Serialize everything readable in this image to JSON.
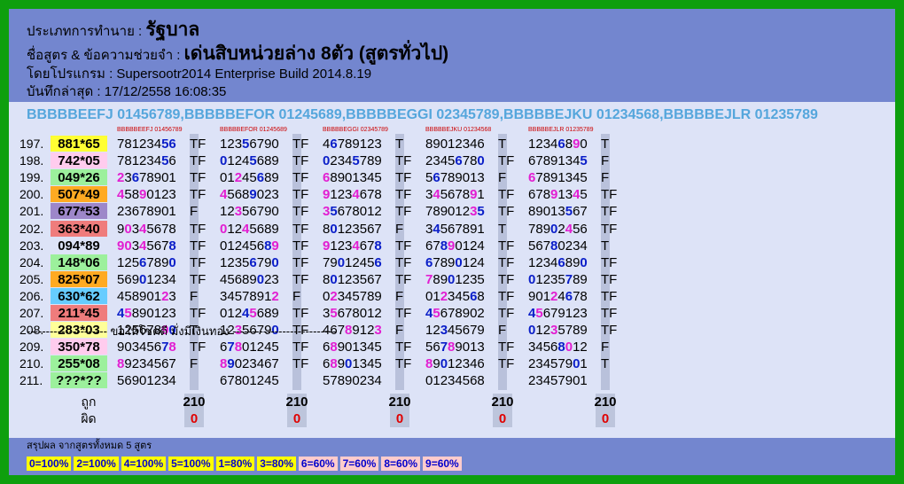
{
  "header": {
    "type_label": "ประเภทการทำนาย :",
    "type_value": "รัฐบาล",
    "name_label": "ชื่อสูตร & ข้อความช่วยจำ :",
    "name_value": "เด่นสิบหน่วยล่าง 8ตัว (สูตรทั่วไป)",
    "program": "โดยโปรแกรม : Supersootr2014 Enterprise Build 2014.8.19",
    "saved": "บันทึกล่าสุด : 17/12/2558 16:08:35"
  },
  "formulas_line": "BBBBBEEFJ 01456789,BBBBBEFOR 01245689,BBBBBEGGI 02345789,BBBBBEJKU 01234568,BBBBBEJLR 01235789",
  "columns": [
    {
      "head": "BBBBBEEFJ 01456789"
    },
    {
      "head": "BBBBBEFOR 01245689"
    },
    {
      "head": "BBBBBEGGI 02345789"
    },
    {
      "head": "BBBBBEJKU 01234568"
    },
    {
      "head": "BBBBBEJLR 01235789"
    }
  ],
  "rows": [
    {
      "no": "197.",
      "pair": "881*65",
      "bg": "#ffff33",
      "cells": [
        {
          "d": "78123456",
          "c": "nnnnnnbb",
          "r": "TF"
        },
        {
          "d": "12356790",
          "c": "nnnbnnnn",
          "r": "TF"
        },
        {
          "d": "46789123",
          "c": "nbnnnnnn",
          "r": "T"
        },
        {
          "d": "89012346",
          "c": "nnnnnnnn",
          "r": "T"
        },
        {
          "d": "12346890",
          "c": "nnnnbnmn",
          "r": "T"
        }
      ]
    },
    {
      "no": "198.",
      "pair": "742*05",
      "bg": "#ffccee",
      "cells": [
        {
          "d": "78123456",
          "c": "nnnnnnbn",
          "r": "TF"
        },
        {
          "d": "01245689",
          "c": "bnnnbnnn",
          "r": "TF"
        },
        {
          "d": "02345789",
          "c": "bnnnbnnn",
          "r": "TF"
        },
        {
          "d": "23456780",
          "c": "nnnnbnnb",
          "r": "TF"
        },
        {
          "d": "67891345",
          "c": "nnnnnnnb",
          "r": "F"
        }
      ]
    },
    {
      "no": "199.",
      "pair": "049*26",
      "bg": "#9cf09c",
      "cells": [
        {
          "d": "23678901",
          "c": "mnbnnnnn",
          "r": "TF"
        },
        {
          "d": "01245689",
          "c": "nnmnnbnn",
          "r": "TF"
        },
        {
          "d": "68901345",
          "c": "mnnnnnnn",
          "r": "TF"
        },
        {
          "d": "56789013",
          "c": "nbnnnnnn",
          "r": "F"
        },
        {
          "d": "67891345",
          "c": "mnnnnnnn",
          "r": "F"
        }
      ]
    },
    {
      "no": "200.",
      "pair": "507*49",
      "bg": "#ffaa22",
      "cells": [
        {
          "d": "45890123",
          "c": "mnnmnnnn",
          "r": "TF"
        },
        {
          "d": "45689023",
          "c": "mnnnbnnn",
          "r": "TF"
        },
        {
          "d": "91234678",
          "c": "mnnnmnnn",
          "r": "TF"
        },
        {
          "d": "34567891",
          "c": "nmnnnnmn",
          "r": "TF"
        },
        {
          "d": "67891345",
          "c": "nnnmnnmn",
          "r": "TF"
        }
      ]
    },
    {
      "no": "201.",
      "pair": "677*53",
      "bg": "#9d87c9",
      "cells": [
        {
          "d": "23678901",
          "c": "nnnnnnnn",
          "r": "F"
        },
        {
          "d": "12356790",
          "c": "nnmnnnnn",
          "r": "TF"
        },
        {
          "d": "35678012",
          "c": "mbnnnnnn",
          "r": "TF"
        },
        {
          "d": "78901235",
          "c": "nnnnnnmb",
          "r": "TF"
        },
        {
          "d": "89013567",
          "c": "nnnnnbnn",
          "r": "TF"
        }
      ]
    },
    {
      "no": "202.",
      "pair": "363*40",
      "bg": "#ef7c7c",
      "cells": [
        {
          "d": "90345678",
          "c": "nmnmnnnn",
          "r": "TF"
        },
        {
          "d": "01245689",
          "c": "mnnmnnnn",
          "r": "TF"
        },
        {
          "d": "80123567",
          "c": "nbnnnnnn",
          "r": "F"
        },
        {
          "d": "34567891",
          "c": "nbnnnnnn",
          "r": "T"
        },
        {
          "d": "78902456",
          "c": "nnnbnmnn",
          "r": "TF"
        }
      ]
    },
    {
      "no": "203.",
      "pair": "094*89",
      "bg": "#dde3f7",
      "cells": [
        {
          "d": "90345678",
          "c": "mmnmnnnb",
          "r": "TF"
        },
        {
          "d": "01245689",
          "c": "nnnnnnbm",
          "r": "TF"
        },
        {
          "d": "91234678",
          "c": "mnnnmnnb",
          "r": "TF"
        },
        {
          "d": "67890124",
          "c": "nnbmnnnn",
          "r": "TF"
        },
        {
          "d": "56780234",
          "c": "nnnbnnnn",
          "r": "T"
        }
      ]
    },
    {
      "no": "204.",
      "pair": "148*06",
      "bg": "#9cf09c",
      "cells": [
        {
          "d": "12567890",
          "c": "nnnbnnnb",
          "r": "TF"
        },
        {
          "d": "12356790",
          "c": "nnnnbnnb",
          "r": "TF"
        },
        {
          "d": "79012456",
          "c": "nnbnnnnb",
          "r": "TF"
        },
        {
          "d": "67890124",
          "c": "bnnnbnnn",
          "r": "TF"
        },
        {
          "d": "12346890",
          "c": "nnnnbnnb",
          "r": "TF"
        }
      ]
    },
    {
      "no": "205.",
      "pair": "825*07",
      "bg": "#ffaa22",
      "cells": [
        {
          "d": "56901234",
          "c": "nnnbnnnn",
          "r": "TF"
        },
        {
          "d": "45689023",
          "c": "nnnnnbnn",
          "r": "TF"
        },
        {
          "d": "80123567",
          "c": "nbnnnnnn",
          "r": "TF"
        },
        {
          "d": "78901235",
          "c": "mnnbnnnn",
          "r": "TF"
        },
        {
          "d": "01235789",
          "c": "bnnnnbnn",
          "r": "TF"
        }
      ]
    },
    {
      "no": "206.",
      "pair": "630*62",
      "bg": "#66ccff",
      "cells": [
        {
          "d": "45890123",
          "c": "nnnnnnmn",
          "r": "F"
        },
        {
          "d": "34578912",
          "c": "nnnnnnnm",
          "r": "F"
        },
        {
          "d": "02345789",
          "c": "nmnnnnnn",
          "r": "F"
        },
        {
          "d": "01234568",
          "c": "nnmnnnbn",
          "r": "TF"
        },
        {
          "d": "90124678",
          "c": "nnnmnbnn",
          "r": "TF"
        }
      ]
    },
    {
      "no": "207.",
      "pair": "211*45",
      "bg": "#ef7c7c",
      "cells": [
        {
          "d": "45890123",
          "c": "bmnnnnnn",
          "r": "TF"
        },
        {
          "d": "01245689",
          "c": "nnnbmnnn",
          "r": "TF"
        },
        {
          "d": "35678012",
          "c": "nmnnnnnn",
          "r": "TF"
        },
        {
          "d": "45678902",
          "c": "bmnnnnnn",
          "r": "TF"
        },
        {
          "d": "45679123",
          "c": "bmnnnnnn",
          "r": "TF"
        }
      ]
    },
    {
      "no": "208.",
      "pair": "283*03",
      "bg": "#ffff99",
      "cells": [
        {
          "d": "12567890",
          "c": "nnnnnnmb",
          "r": "T"
        },
        {
          "d": "12356790",
          "c": "nnmnnnnb",
          "r": "TF"
        },
        {
          "d": "46789123",
          "c": "nnnmnnnm",
          "r": "F"
        },
        {
          "d": "12345679",
          "c": "nnbnnnnn",
          "r": "F"
        },
        {
          "d": "01235789",
          "c": "bnnmnnnn",
          "r": "TF"
        }
      ]
    },
    {
      "no": "209.",
      "pair": "350*78",
      "bg": "#ffccee",
      "cells": [
        {
          "d": "90345678",
          "c": "nnnnnnbm",
          "r": "TF"
        },
        {
          "d": "67801245",
          "c": "nbmnnnnn",
          "r": "TF"
        },
        {
          "d": "68901345",
          "c": "nmnnnnnn",
          "r": "TF"
        },
        {
          "d": "56789013",
          "c": "nnbmnnnn",
          "r": "TF"
        },
        {
          "d": "34568012",
          "c": "nnnnbmnn",
          "r": "F"
        }
      ]
    },
    {
      "no": "210.",
      "pair": "255*08",
      "bg": "#9cf09c",
      "cells": [
        {
          "d": "89234567",
          "c": "mnnnnnnn",
          "r": "F"
        },
        {
          "d": "89023467",
          "c": "mbnnnnnn",
          "r": "TF"
        },
        {
          "d": "68901345",
          "c": "nmnbnnnn",
          "r": "TF"
        },
        {
          "d": "89012346",
          "c": "mnbnnnnn",
          "r": "TF"
        },
        {
          "d": "23457901",
          "c": "nnnnnnbn",
          "r": "T"
        }
      ]
    },
    {
      "no": "211.",
      "pair": "???*??",
      "bg": "#9cf09c",
      "cells": [
        {
          "d": "56901234",
          "c": "nnnnnnnn",
          "r": ""
        },
        {
          "d": "67801245",
          "c": "nnnnnnnn",
          "r": ""
        },
        {
          "d": "57890234",
          "c": "nnnnnnnn",
          "r": ""
        },
        {
          "d": "01234568",
          "c": "nnnnnnnn",
          "r": ""
        },
        {
          "d": "23457901",
          "c": "nnnnnnnn",
          "r": ""
        }
      ]
    }
  ],
  "totals": {
    "correct_label": "ถูก",
    "wrong_label": "ผิด",
    "correct": [
      "210",
      "210",
      "210",
      "210",
      "210"
    ],
    "wrong": [
      "0",
      "0",
      "0",
      "0",
      "0"
    ]
  },
  "divider": "--------------------- ขอให้โชคดี มั่งมีเงินทอง ---------------------------",
  "summary": {
    "title": "สรุปผล จากสูตรทั้งหมด 5 สูตร",
    "badges": [
      {
        "text": "0=100%",
        "bg": "#ffff00",
        "fg": "#0000cc"
      },
      {
        "text": "2=100%",
        "bg": "#ffff00",
        "fg": "#0000cc"
      },
      {
        "text": "4=100%",
        "bg": "#ffff00",
        "fg": "#0000cc"
      },
      {
        "text": "5=100%",
        "bg": "#ffff00",
        "fg": "#0000cc"
      },
      {
        "text": "1=80%",
        "bg": "#ffff00",
        "fg": "#0000cc"
      },
      {
        "text": "3=80%",
        "bg": "#ffff00",
        "fg": "#0000cc"
      },
      {
        "text": "6=60%",
        "bg": "#ffcccc",
        "fg": "#0000cc"
      },
      {
        "text": "7=60%",
        "bg": "#ffcccc",
        "fg": "#0000cc"
      },
      {
        "text": "8=60%",
        "bg": "#ffcccc",
        "fg": "#0000cc"
      },
      {
        "text": "9=60%",
        "bg": "#ffcccc",
        "fg": "#0000cc"
      }
    ]
  }
}
